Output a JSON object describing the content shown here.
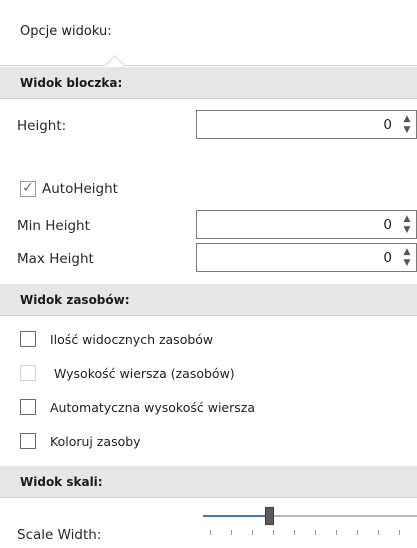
{
  "panel": {
    "title": "Opcje widoku:"
  },
  "sections": {
    "block_view": "Widok bloczka:",
    "resources_view": "Widok zasobów:",
    "scale_view": "Widok skali:"
  },
  "block": {
    "height_label": "Height:",
    "height_value": "0",
    "autoheight_label": "AutoHeight",
    "autoheight_checked": true,
    "min_height_label": "Min Height",
    "min_height_value": "0",
    "max_height_label": "Max Height",
    "max_height_value": "0"
  },
  "resources": {
    "visible_count_label": "Ilość widocznych zasobów",
    "row_height_label": "Wysokość wiersza (zasobów)",
    "auto_row_height_label": "Automatyczna wysokość wiersza",
    "color_resources_label": "Koloruj zasoby"
  },
  "scale": {
    "scale_width_label": "Scale Width:",
    "slider_position": 0.3
  },
  "icons": {
    "spin_up": "▲",
    "spin_down": "▼",
    "check": "✓"
  }
}
